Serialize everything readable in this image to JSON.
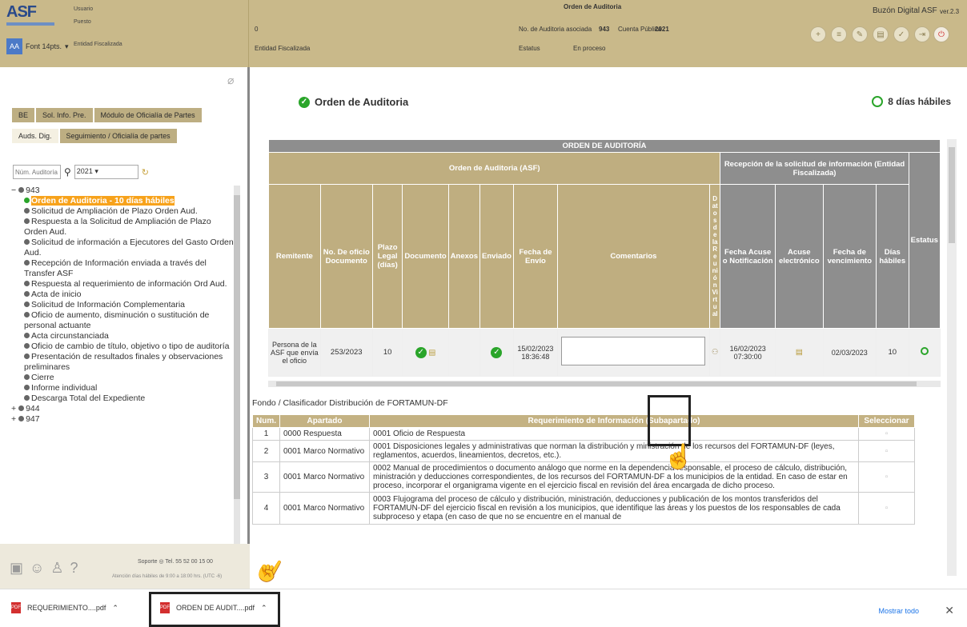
{
  "header": {
    "logo": "ASF",
    "usuario_lbl": "Usuario",
    "puesto_lbl": "Puesto",
    "entidad_lbl": "Entidad Fiscalizada",
    "font_lbl": "Font 14pts.",
    "zero": "0",
    "entidad_fiscalizada": "Entidad Fiscalizada",
    "orden_title": "Orden de Auditoria",
    "no_aud_lbl": "No. de Auditoria asociada",
    "no_aud": "943",
    "cuenta_lbl": "Cuenta Pública",
    "cuenta": "2021",
    "estatus_lbl": "Estatus",
    "estatus": "En proceso",
    "buzon": "Buzón Digital ASF",
    "version": "ver.2.3"
  },
  "left": {
    "tabs1": [
      "BE",
      "Sol. Info. Pre.",
      "Módulo de Oficialía de Partes"
    ],
    "tabs2": [
      "Auds. Dig.",
      "Seguimiento / Oficialía de partes"
    ],
    "search_placeholder": "Núm. Auditoría a E",
    "year": "2021",
    "root": "943",
    "items": [
      "Orden de Auditoria - 10 días hábiles",
      "Solicitud de Ampliación de Plazo Orden Aud.",
      "Respuesta a la Solicitud de Ampliación de Plazo Orden Aud.",
      "Solicitud de información a Ejecutores del Gasto Orden Aud.",
      "Recepción de Información enviada a través del Transfer ASF",
      "Respuesta al requerimiento de información Ord Aud.",
      "Acta de inicio",
      "Solicitud de Información Complementaria",
      "Oficio de aumento, disminución o sustitución de personal actuante",
      "Acta circunstanciada",
      "Oficio de cambio de título, objetivo o tipo de auditoría",
      "Presentación de resultados finales y observaciones preliminares",
      "Cierre",
      "Informe individual",
      "Descarga Total del Expediente"
    ],
    "others": [
      "944",
      "947"
    ],
    "soporte": "Soporte",
    "telefono": "Tel. 55 52 00 15 00",
    "atencion": "Atención días hábiles de 9:00 a 18:00 hrs. (UTC -6)"
  },
  "main": {
    "title": "Orden de Auditoria",
    "dias": "8 días hábiles",
    "table_title": "ORDEN DE AUDITORÍA",
    "grp1": "Orden de Auditoria (ASF)",
    "grp2": "Recepción de la solicitud de información (Entidad Fiscalizada)",
    "cols": [
      "Remitente",
      "No. De oficio Documento",
      "Plazo Legal (días)",
      "Documento",
      "Anexos",
      "Enviado",
      "Fecha de Envío",
      "Comentarios",
      "Datos de la Reunión Virtual",
      "Fecha Acuse o Notificación",
      "Acuse electrónico",
      "Fecha de vencimiento",
      "Días hábiles",
      "Estatus"
    ],
    "row": {
      "remitente": "Persona de la ASF que envía el oficio",
      "oficio": "253/2023",
      "plazo": "10",
      "fecha_envio": "15/02/2023 18:36:48",
      "fecha_acuse": "16/02/2023 07:30:00",
      "fecha_venc": "02/03/2023",
      "dias": "10"
    },
    "fondo": "Fondo / Clasificador  Distribución de FORTAMUN-DF",
    "req_cols": [
      "Num.",
      "Apartado",
      "Requerimiento de Información (Subapartado)",
      "Seleccionar"
    ],
    "req_rows": [
      {
        "n": "1",
        "ap": "0000 Respuesta",
        "req": "0001 Oficio de Respuesta"
      },
      {
        "n": "2",
        "ap": "0001 Marco Normativo",
        "req": "0001 Disposiciones legales y administrativas que norman la distribución y ministración de los recursos del FORTAMUN-DF (leyes, reglamentos, acuerdos, lineamientos, decretos, etc.)."
      },
      {
        "n": "3",
        "ap": "0001 Marco Normativo",
        "req": "0002 Manual de procedimientos o documento análogo que norme en la dependencia responsable, el proceso de cálculo, distribución, ministración y deducciones correspondientes, de los recursos del FORTAMUN-DF a los municipios de la entidad. En caso de estar en proceso, incorporar el organigrama vigente en el ejercicio fiscal en revisión del área encargada de dicho proceso."
      },
      {
        "n": "4",
        "ap": "0001 Marco Normativo",
        "req": "0003 Flujograma del proceso de cálculo y distribución, ministración, deducciones y publicación de los montos transferidos del FORTAMUN-DF del ejercicio fiscal en revisión a los municipios, que identifique las áreas y los puestos de los responsables de cada subproceso y etapa (en caso de que no se encuentre en el manual de"
      }
    ]
  },
  "downloads": {
    "items": [
      "REQUERIMIENTO....pdf",
      "ORDEN DE AUDIT....pdf"
    ],
    "mostrar": "Mostrar todo"
  }
}
